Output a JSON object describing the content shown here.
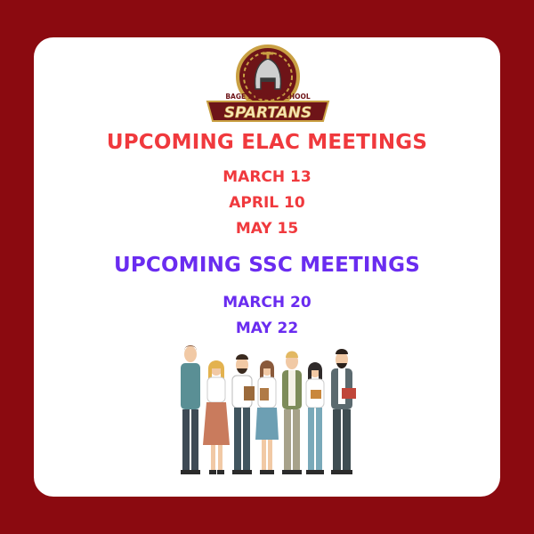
{
  "logo": {
    "school_name": "BAGE MIDDLE SCHOOL",
    "team_name": "SPARTANS",
    "colors": {
      "maroon": "#6e1418",
      "gold": "#c9a043",
      "cream": "#f6e6b8"
    }
  },
  "elac": {
    "heading": "UPCOMING ELAC MEETINGS",
    "dates": [
      "MARCH 13",
      "APRIL 10",
      "MAY 15"
    ],
    "color": "#f0393d"
  },
  "ssc": {
    "heading": "UPCOMING SSC MEETINGS",
    "dates": [
      "MARCH 20",
      "MAY 22"
    ],
    "color": "#6a2cf0"
  },
  "background_color": "#8b0a10",
  "illustration": "group-of-teachers-illustration"
}
